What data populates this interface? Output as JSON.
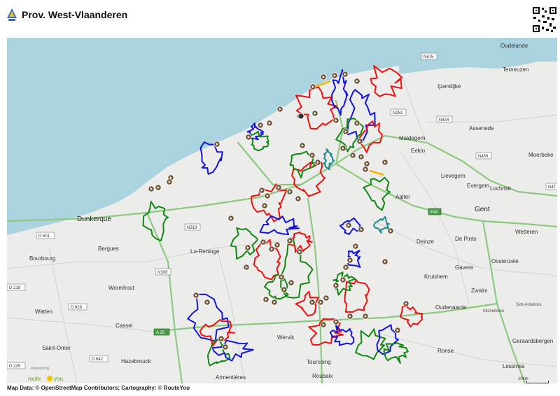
{
  "header": {
    "title": "Prov. West-Vlaanderen"
  },
  "map": {
    "colors": {
      "sea": "#abd3df",
      "land": "#ececea",
      "major_road": "#8cc97e",
      "route_red": "#ee1111",
      "route_blue": "#1515dd",
      "route_green": "#118811",
      "route_teal": "#1a8a8a",
      "route_orange": "#f0b400"
    },
    "places": [
      "Oudelande",
      "Terneuzen",
      "Ijzendijke",
      "Maldegem",
      "Assenede",
      "Eeklo",
      "Moerbeke",
      "Lievegem",
      "Evergem",
      "Lochristi",
      "Aalter",
      "Gent",
      "Wetteren",
      "Deinze",
      "De Pinte",
      "Oosterzele",
      "Gavere",
      "Kruishem",
      "Zwalm",
      "Oudenaarde",
      "Sint-Antelinks",
      "Michelbeke",
      "Geraardsbergen",
      "Ronse",
      "Lessines",
      "Dunkerque",
      "Bergues",
      "Bourbourg",
      "Lo-Reninge",
      "Wormhout",
      "Watten",
      "Cassel",
      "Saint-Omer",
      "Hazebrouck",
      "Wervik",
      "Armentières",
      "Tourcoing",
      "Roubaix"
    ],
    "road_shields": [
      "N675",
      "N251",
      "N434",
      "N458",
      "N47",
      "E40",
      "N319",
      "D 601",
      "N308",
      "D 218",
      "D 928",
      "A 25",
      "D 642",
      "D 225"
    ],
    "route_markers_count": 70,
    "scale_label": "10km"
  },
  "footer": {
    "attribution": "Map Data: © OpenStreetMap Contributors; Cartography: ©  RouteYou",
    "powered_by": "Powered by",
    "brand_left": "route",
    "brand_right": "you"
  }
}
